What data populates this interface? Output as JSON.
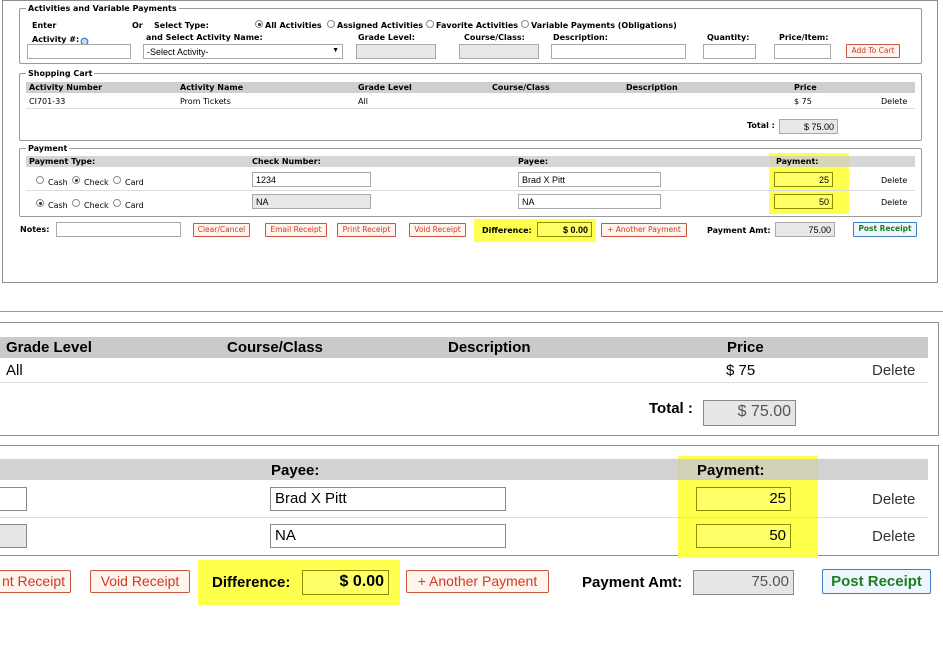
{
  "activities": {
    "legend": "Activities and Variable Payments",
    "enter_label": "Enter",
    "activity_num_label": "Activity #:",
    "or_label": "Or",
    "select_type_label": "Select Type:",
    "select_name_label": "and Select Activity Name:",
    "types": [
      {
        "label": "All Activities",
        "selected": true
      },
      {
        "label": "Assigned Activities",
        "selected": false
      },
      {
        "label": "Favorite Activities",
        "selected": false
      },
      {
        "label": "Variable Payments (Obligations)",
        "selected": false
      }
    ],
    "activity_select_value": "-Select Activity-",
    "grade_level_label": "Grade Level:",
    "course_class_label": "Course/Class:",
    "description_label": "Description:",
    "quantity_label": "Quantity:",
    "price_item_label": "Price/Item:",
    "add_to_cart_label": "Add To Cart"
  },
  "cart": {
    "legend": "Shopping Cart",
    "columns": [
      "Activity Number",
      "Activity Name",
      "Grade Level",
      "Course/Class",
      "Description",
      "Price"
    ],
    "rows": [
      {
        "activity_number": "CI701-33",
        "activity_name": "Prom Tickets",
        "grade_level": "All",
        "course_class": "",
        "description": "",
        "price": "$ 75",
        "delete": "Delete"
      }
    ],
    "total_label": "Total :",
    "total_value": "$ 75.00"
  },
  "payment": {
    "legend": "Payment",
    "columns": [
      "Payment Type:",
      "Check Number:",
      "Payee:",
      "Payment:"
    ],
    "type_options": [
      "Cash",
      "Check",
      "Card"
    ],
    "rows": [
      {
        "type": "Check",
        "check_number": "1234",
        "payee": "Brad X Pitt",
        "amount": "25",
        "delete": "Delete"
      },
      {
        "type": "Cash",
        "check_number": "NA",
        "payee": "NA",
        "amount": "50",
        "delete": "Delete"
      }
    ]
  },
  "footer": {
    "notes_label": "Notes:",
    "clear_label": "Clear/Cancel",
    "email_label": "Email Receipt",
    "print_label": "Print Receipt",
    "void_label": "Void Receipt",
    "difference_label": "Difference:",
    "difference_value": "$ 0.00",
    "another_payment_label": "+ Another Payment",
    "payment_amt_label": "Payment Amt:",
    "payment_amt_value": "75.00",
    "post_receipt_label": "Post Receipt"
  },
  "zoom": {
    "print_partial": "nt Receipt"
  },
  "colors": {
    "highlight": "#ffff4d",
    "button_text": "#d03a1f",
    "post_text": "#1e7e1e",
    "header_gray": "#cfcfcf"
  }
}
